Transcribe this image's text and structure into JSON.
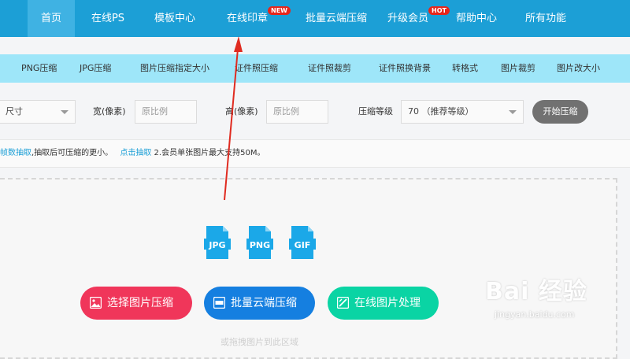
{
  "topnav": {
    "items": [
      "首页",
      "在线PS",
      "模板中心",
      "在线印章",
      "批量云端压缩",
      "升级会员",
      "帮助中心",
      "所有功能"
    ],
    "badges": {
      "new": "NEW",
      "hot": "HOT"
    }
  },
  "subnav": {
    "items": [
      "PNG压缩",
      "JPG压缩",
      "图片压缩指定大小",
      "证件照压缩",
      "证件照裁剪",
      "证件照换背景",
      "转格式",
      "图片裁剪",
      "图片改大小"
    ]
  },
  "options": {
    "size_select": "尺寸",
    "width_label": "宽(像素)",
    "width_placeholder": "原比例",
    "height_label": "高(像素)",
    "height_placeholder": "原比例",
    "level_label": "压缩等级",
    "level_value": "70 （推荐等级）",
    "start_button": "开始压缩"
  },
  "notice": {
    "link1": "帧数抽取",
    "text1": ",抽取后可压缩的更小。",
    "link2": "点击抽取",
    "text2": " 2.会员单张图片最大支持50M。"
  },
  "upload": {
    "formats": [
      "JPG",
      "PNG",
      "GIF"
    ],
    "select_button": "选择图片压缩",
    "batch_button": "批量云端压缩",
    "online_button": "在线图片处理",
    "hint": "或拖拽图片到此区域"
  },
  "watermark": {
    "brand": "Bai 经验",
    "url": "jingyan.baidu.com"
  },
  "colors": {
    "nav": "#1c9fd6",
    "subnav": "#9ee6f9",
    "red": "#f0365a",
    "blue": "#157fe0",
    "green": "#0ad4a4",
    "badge": "#e8261b"
  }
}
